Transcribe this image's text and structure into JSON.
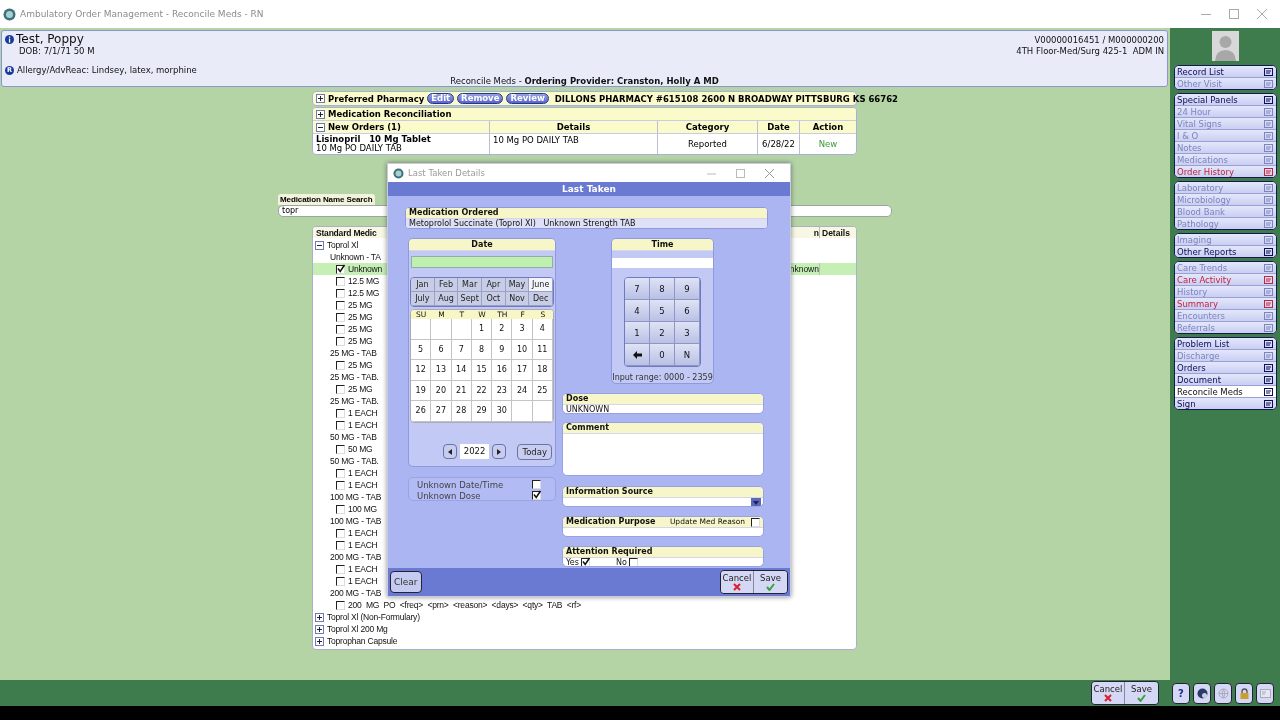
{
  "window": {
    "title": "Ambulatory Order Management - Reconcile Meds - RN"
  },
  "patient": {
    "name": "Test, Poppy",
    "dob": "DOB: 7/1/71 50 M",
    "allergy_mark": "R",
    "allergy": "Allergy/AdvReac: Lindsey, latex, morphine",
    "ids": "V00000016451 / M000000200",
    "location": "4TH Floor-Med/Surg 425-1  ADM IN",
    "context": "Reconcile Meds - **Ordering Provider: Cranston, Holly A MD**"
  },
  "pharmacy": {
    "label": "Preferred Pharmacy",
    "expanded": false,
    "buttons": [
      "Edit",
      "Remove",
      "Review"
    ],
    "value": "DILLONS PHARMACY #615108 2600 N BROADWAY PITTSBURG KS 66762"
  },
  "reconciliation": {
    "label": "Medication Reconciliation",
    "expanded": false
  },
  "new_orders": {
    "label": "New Orders (1)",
    "expanded": true,
    "columns": [
      "Details",
      "Category",
      "Date",
      "Action"
    ],
    "rows": [
      {
        "name": "Lisinopril   10 Mg Tablet",
        "sig": "10 Mg PO DAILY TAB",
        "details": "10 Mg PO DAILY TAB",
        "category": "Reported",
        "date": "6/28/22",
        "action": "New"
      }
    ]
  },
  "search": {
    "label": "Medication Name Search",
    "value": "topr"
  },
  "med_list": {
    "columns": [
      "Standard Medic",
      "n",
      "Details"
    ],
    "tree": [
      {
        "label": "Toprol Xl",
        "expanded": true,
        "children": [
          {
            "label": "Unknown - TA",
            "children": [
              {
                "label": "Unknown",
                "checked": true,
                "selected": true,
                "details": "nknown"
              },
              {
                "label": "12.5 MG",
                "checked": false,
                "selected": false
              },
              {
                "label": "12.5 MG",
                "checked": false,
                "selected": false
              },
              {
                "label": "25 MG",
                "checked": false,
                "selected": false
              },
              {
                "label": "25 MG",
                "checked": false,
                "selected": false
              },
              {
                "label": "25 MG",
                "checked": false,
                "selected": false
              },
              {
                "label": "25 MG",
                "checked": false,
                "selected": false
              }
            ]
          },
          {
            "label": "25 MG - TAB",
            "children": [
              {
                "label": "25 MG",
                "checked": false,
                "selected": false
              }
            ]
          },
          {
            "label": "25 MG - TAB.",
            "children": [
              {
                "label": "25 MG",
                "checked": false,
                "selected": false
              }
            ]
          },
          {
            "label": "25 MG - TAB.",
            "children": [
              {
                "label": "1 EACH",
                "checked": false,
                "selected": false
              },
              {
                "label": "1 EACH",
                "checked": false,
                "selected": false
              }
            ]
          },
          {
            "label": "50 MG - TAB",
            "children": [
              {
                "label": "50 MG",
                "checked": false,
                "selected": false
              }
            ]
          },
          {
            "label": "50 MG - TAB.",
            "children": [
              {
                "label": "1 EACH",
                "checked": false,
                "selected": false
              },
              {
                "label": "1 EACH",
                "checked": false,
                "selected": false
              }
            ]
          },
          {
            "label": "100 MG - TAB",
            "children": [
              {
                "label": "100 MG",
                "checked": false,
                "selected": false
              }
            ]
          },
          {
            "label": "100 MG - TAB",
            "children": [
              {
                "label": "1 EACH",
                "checked": false,
                "selected": false
              },
              {
                "label": "1 EACH",
                "checked": false,
                "selected": false
              }
            ]
          },
          {
            "label": "200 MG - TAB",
            "children": [
              {
                "label": "1 EACH",
                "checked": false,
                "selected": false
              },
              {
                "label": "1 EACH",
                "checked": false,
                "selected": false
              }
            ]
          },
          {
            "label": "200 MG - TAB",
            "children": [
              {
                "label": "200  MG  PO  <freq>  <prn>  <reason>  <days>  <qty>  TAB  <rf>",
                "checked": false,
                "selected": false
              }
            ]
          }
        ]
      },
      {
        "label": "Toprol Xl (Non-Formulary)",
        "expanded": false
      },
      {
        "label": "Toprol Xl 200 Mg",
        "expanded": false
      },
      {
        "label": "Toprophan Capsule",
        "expanded": false
      }
    ]
  },
  "dialog": {
    "title": "Last Taken Details",
    "heading": "Last Taken",
    "medication": {
      "label": "Medication Ordered",
      "value": "Metoprolol Succinate (Toprol Xl)   Unknown Strength TAB"
    },
    "date": {
      "label": "Date",
      "months": [
        {
          "label": "Jan",
          "selected": false
        },
        {
          "label": "Feb",
          "selected": false
        },
        {
          "label": "Mar",
          "selected": false
        },
        {
          "label": "Apr",
          "selected": false
        },
        {
          "label": "May",
          "selected": false
        },
        {
          "label": "June",
          "selected": true
        },
        {
          "label": "July",
          "selected": false
        },
        {
          "label": "Aug",
          "selected": false
        },
        {
          "label": "Sept",
          "selected": false
        },
        {
          "label": "Oct",
          "selected": false
        },
        {
          "label": "Nov",
          "selected": false
        },
        {
          "label": "Dec",
          "selected": false
        }
      ],
      "weekdays": [
        "SU",
        "M",
        "T",
        "W",
        "TH",
        "F",
        "S"
      ],
      "weeks": [
        [
          {
            "kind": "blank"
          },
          {
            "kind": "blank"
          },
          {
            "kind": "blank"
          },
          {
            "kind": "day",
            "label": "1"
          },
          {
            "kind": "day",
            "label": "2"
          },
          {
            "kind": "day",
            "label": "3"
          },
          {
            "kind": "day",
            "label": "4"
          }
        ],
        [
          {
            "kind": "day",
            "label": "5"
          },
          {
            "kind": "day",
            "label": "6"
          },
          {
            "kind": "day",
            "label": "7"
          },
          {
            "kind": "day",
            "label": "8"
          },
          {
            "kind": "day",
            "label": "9"
          },
          {
            "kind": "day",
            "label": "10"
          },
          {
            "kind": "day",
            "label": "11"
          }
        ],
        [
          {
            "kind": "day",
            "label": "12"
          },
          {
            "kind": "day",
            "label": "13"
          },
          {
            "kind": "day",
            "label": "14"
          },
          {
            "kind": "day",
            "label": "15"
          },
          {
            "kind": "day",
            "label": "16"
          },
          {
            "kind": "day",
            "label": "17"
          },
          {
            "kind": "day",
            "label": "18"
          }
        ],
        [
          {
            "kind": "day",
            "label": "19"
          },
          {
            "kind": "day",
            "label": "20"
          },
          {
            "kind": "day",
            "label": "21"
          },
          {
            "kind": "day",
            "label": "22"
          },
          {
            "kind": "day",
            "label": "23"
          },
          {
            "kind": "day",
            "label": "24"
          },
          {
            "kind": "day",
            "label": "25"
          }
        ],
        [
          {
            "kind": "day",
            "label": "26"
          },
          {
            "kind": "day",
            "label": "27"
          },
          {
            "kind": "day",
            "label": "28"
          },
          {
            "kind": "day",
            "label": "29"
          },
          {
            "kind": "day",
            "label": "30"
          },
          {
            "kind": "blank"
          },
          {
            "kind": "blank"
          }
        ]
      ],
      "year": "2022",
      "today": "Today"
    },
    "unknown_options": [
      {
        "label": "Unknown Date/Time",
        "checked": false
      },
      {
        "label": "Unknown Dose",
        "checked": true
      }
    ],
    "time": {
      "label": "Time",
      "keys": [
        {
          "kind": "digit",
          "label": "7"
        },
        {
          "kind": "digit",
          "label": "8"
        },
        {
          "kind": "digit",
          "label": "9"
        },
        {
          "kind": "digit",
          "label": "4"
        },
        {
          "kind": "digit",
          "label": "5"
        },
        {
          "kind": "digit",
          "label": "6"
        },
        {
          "kind": "digit",
          "label": "1"
        },
        {
          "kind": "digit",
          "label": "2"
        },
        {
          "kind": "digit",
          "label": "3"
        },
        {
          "kind": "back"
        },
        {
          "kind": "digit",
          "label": "0"
        },
        {
          "kind": "digit",
          "label": "N"
        }
      ],
      "range": "Input range: 0000 - 2359"
    },
    "dose": {
      "label": "Dose",
      "value": "UNKNOWN"
    },
    "comment": {
      "label": "Comment"
    },
    "information_source": {
      "label": "Information Source"
    },
    "purpose": {
      "label": "Medication Purpose",
      "option": {
        "label": "Update Med Reason",
        "checked": false
      }
    },
    "attention": {
      "label": "Attention Required",
      "options": [
        {
          "label": "Yes",
          "checked": true
        },
        {
          "label": "No",
          "checked": false
        }
      ]
    },
    "buttons": {
      "clear": "Clear",
      "cancel": "Cancel",
      "save": "Save"
    }
  },
  "sidebar": {
    "groups": [
      {
        "items": [
          {
            "label": "Record List",
            "kind": "normal",
            "selected": false
          },
          {
            "label": "Other Visit",
            "kind": "disabled",
            "selected": false
          }
        ]
      },
      {
        "items": [
          {
            "label": "Special Panels",
            "kind": "normal",
            "selected": false
          },
          {
            "label": "24 Hour",
            "kind": "disabled",
            "selected": false
          },
          {
            "label": "Vital Signs",
            "kind": "disabled",
            "selected": false
          },
          {
            "label": "I & O",
            "kind": "disabled",
            "selected": false
          },
          {
            "label": "Notes",
            "kind": "disabled",
            "selected": false
          },
          {
            "label": "Medications",
            "kind": "disabled",
            "selected": false
          },
          {
            "label": "Order History",
            "kind": "alert",
            "selected": false
          }
        ]
      },
      {
        "items": [
          {
            "label": "Laboratory",
            "kind": "disabled",
            "selected": false
          },
          {
            "label": "Microbiology",
            "kind": "disabled",
            "selected": false
          },
          {
            "label": "Blood Bank",
            "kind": "disabled",
            "selected": false
          },
          {
            "label": "Pathology",
            "kind": "disabled",
            "selected": false
          }
        ]
      },
      {
        "items": [
          {
            "label": "Imaging",
            "kind": "disabled",
            "selected": false
          },
          {
            "label": "Other Reports",
            "kind": "normal",
            "selected": false
          }
        ]
      },
      {
        "items": [
          {
            "label": "Care Trends",
            "kind": "disabled",
            "selected": false
          },
          {
            "label": "Care Activity",
            "kind": "alert",
            "selected": false
          },
          {
            "label": "History",
            "kind": "disabled",
            "selected": false
          },
          {
            "label": "Summary",
            "kind": "alert",
            "selected": false
          },
          {
            "label": "Encounters",
            "kind": "disabled",
            "selected": false
          },
          {
            "label": "Referrals",
            "kind": "disabled",
            "selected": false
          }
        ]
      },
      {
        "items": [
          {
            "label": "Problem List",
            "kind": "normal",
            "selected": false
          },
          {
            "label": "Discharge",
            "kind": "disabled",
            "selected": false
          },
          {
            "label": "Orders",
            "kind": "normal",
            "selected": false
          },
          {
            "label": "Document",
            "kind": "normal",
            "selected": false
          },
          {
            "label": "Reconcile Meds",
            "kind": "normal",
            "selected": true
          },
          {
            "label": "Sign",
            "kind": "normal",
            "selected": false
          }
        ]
      }
    ]
  },
  "footer": {
    "cancel": "Cancel",
    "save": "Save",
    "help": "?"
  }
}
